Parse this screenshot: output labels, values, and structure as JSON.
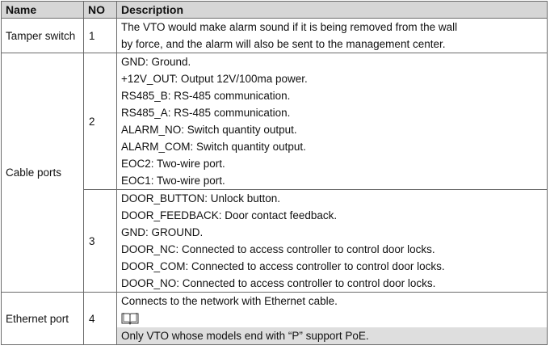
{
  "table": {
    "headers": {
      "name": "Name",
      "no": "NO",
      "description": "Description"
    },
    "rows": [
      {
        "name": "Tamper switch",
        "no": "1",
        "lines": [
          "The VTO would make alarm sound if it is being removed from the wall",
          "by force, and the alarm will also be sent to the management center."
        ]
      },
      {
        "name": "Cable ports",
        "no": "2",
        "lines": [
          "GND: Ground.",
          "+12V_OUT: Output 12V/100ma power.",
          "RS485_B: RS-485 communication.",
          "RS485_A: RS-485 communication.",
          "ALARM_NO: Switch quantity output.",
          "ALARM_COM: Switch quantity output.",
          "EOC2: Two-wire port.",
          "EOC1: Two-wire port."
        ]
      },
      {
        "name": "",
        "no": "3",
        "lines": [
          "DOOR_BUTTON: Unlock button.",
          "DOOR_FEEDBACK: Door contact feedback.",
          "GND: GROUND.",
          "DOOR_NC: Connected to access controller to control door locks.",
          "DOOR_COM: Connected to access controller to control door locks.",
          "DOOR_NO: Connected to access controller to control door locks."
        ]
      },
      {
        "name": "Ethernet port",
        "no": "4",
        "lines": [
          "Connects to the network with Ethernet cable."
        ],
        "note_icon": "open-book-icon",
        "note": "Only VTO whose models end with “P” support PoE."
      }
    ]
  },
  "colors": {
    "header_background": "#d6d6d6",
    "note_background": "#dedede",
    "border": "#6b6b6b"
  }
}
